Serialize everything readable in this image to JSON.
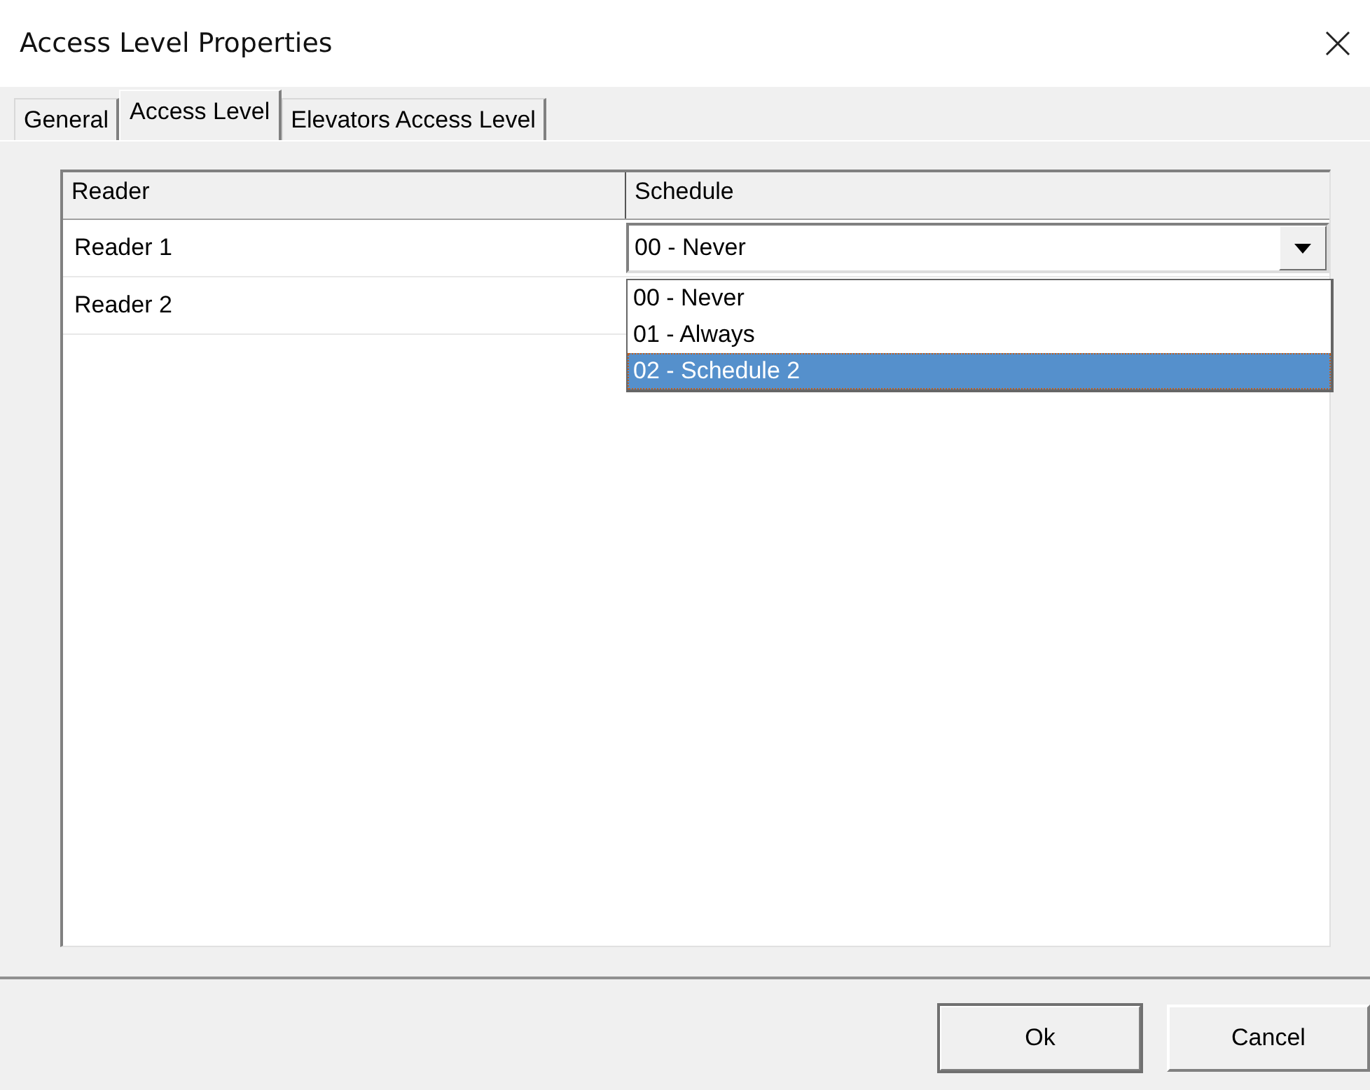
{
  "window": {
    "title": "Access Level Properties"
  },
  "tabs": [
    {
      "label": "General",
      "selected": false
    },
    {
      "label": "Access Level",
      "selected": true
    },
    {
      "label": "Elevators Access Level",
      "selected": false
    }
  ],
  "grid": {
    "columns": [
      "Reader",
      "Schedule"
    ],
    "rows": [
      {
        "reader": "Reader 1",
        "schedule": "00 - Never",
        "editing": true
      },
      {
        "reader": "Reader 2"
      }
    ]
  },
  "dropdown": {
    "options": [
      {
        "label": "00 - Never",
        "selected": false
      },
      {
        "label": "01 - Always",
        "selected": false
      },
      {
        "label": "02 - Schedule 2",
        "selected": true
      }
    ]
  },
  "buttons": [
    {
      "label": "Ok",
      "default": true
    },
    {
      "label": "Cancel",
      "default": false
    }
  ]
}
